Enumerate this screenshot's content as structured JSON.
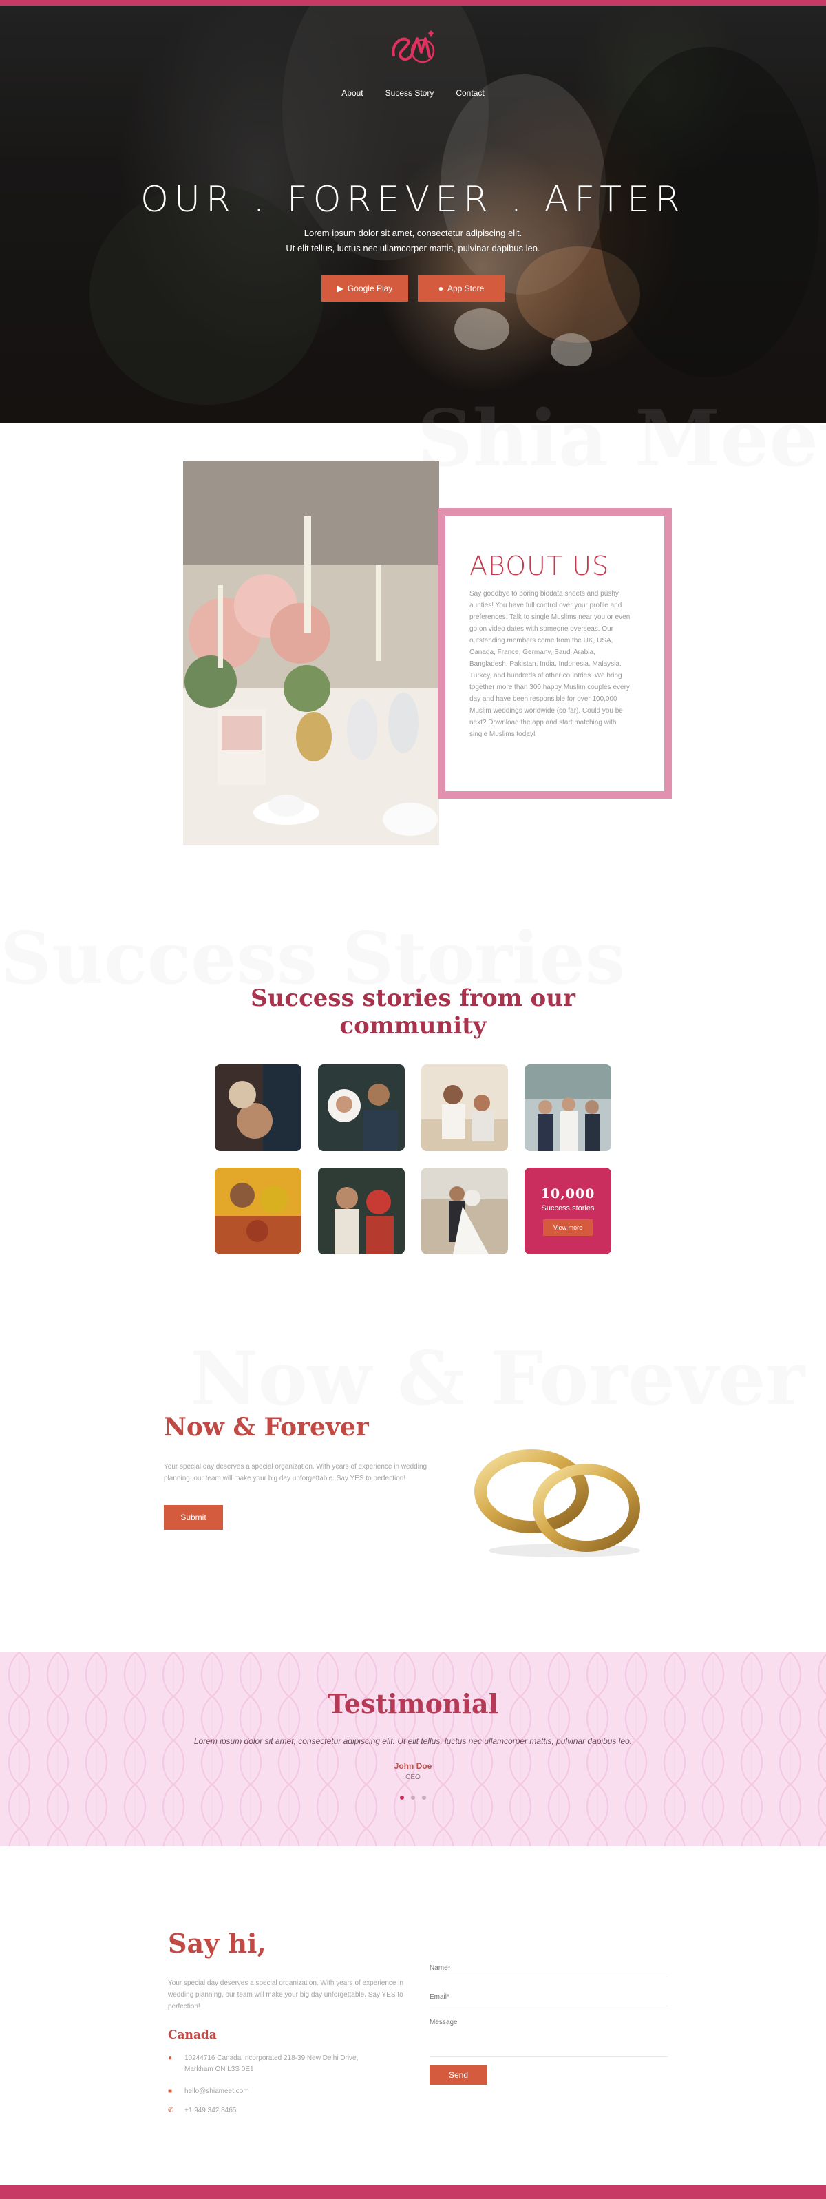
{
  "brand": {
    "logo_text": "SM"
  },
  "nav": {
    "items": [
      "About",
      "Sucess Story",
      "Contact"
    ]
  },
  "hero": {
    "title": "OUR . FOREVER . AFTER",
    "subtitle_line1": "Lorem ipsum dolor sit amet, consectetur adipiscing elit.",
    "subtitle_line2": "Ut elit tellus, luctus nec ullamcorper mattis, pulvinar dapibus leo.",
    "google_play_label": "Google Play",
    "app_store_label": "App Store"
  },
  "about": {
    "watermark": "Shia Meet",
    "title": "ABOUT US",
    "text": "Say goodbye to boring biodata sheets and pushy aunties! You have full control over your profile and preferences. Talk to single Muslims near you or even go on video dates with someone overseas. Our outstanding members come from the UK, USA, Canada, France, Germany, Saudi Arabia, Bangladesh, Pakistan, India, Indonesia, Malaysia, Turkey, and hundreds of other countries. We bring together more than 300 happy Muslim couples every day and have been responsible for over 100,000 Muslim weddings worldwide (so far). Could you be next? Download the app and start matching with single Muslims today!"
  },
  "success": {
    "watermark": "Success Stories",
    "title_line1": "Success stories from our",
    "title_line2": "community",
    "stat_number": "10,000",
    "stat_label": "Success stories",
    "view_more_label": "View more"
  },
  "forever": {
    "watermark": "Now & Forever",
    "title": "Now & Forever",
    "text": "Your special day deserves a special organization. With years of experience in wedding planning, our team will make your big day unforgettable. Say YES to perfection!",
    "button_label": "Submit"
  },
  "testimonial": {
    "title": "Testimonial",
    "quote": "Lorem ipsum dolor sit amet, consectetur adipiscing elit. Ut elit tellus, luctus nec ullamcorper mattis, pulvinar dapibus leo.",
    "name": "John Doe",
    "role": "CEO"
  },
  "contact": {
    "title": "Say hi,",
    "text": "Your special day deserves a special organization. With years of experience in wedding planning, our team will make your big day unforgettable. Say YES to perfection!",
    "country": "Canada",
    "address_line1": "10244716 Canada Incorporated 218-39 New Delhi Drive,",
    "address_line2": "Markham ON L3S 0E1",
    "email": "hello@shiameet.com",
    "phone": "+1 949 342 8465",
    "name_placeholder": "Name*",
    "email_placeholder": "Email*",
    "message_placeholder": "Message",
    "send_label": "Send"
  },
  "colors": {
    "brand_pink": "#c73a66",
    "accent_orange": "#d55b3f",
    "about_frame": "#e190ad"
  }
}
